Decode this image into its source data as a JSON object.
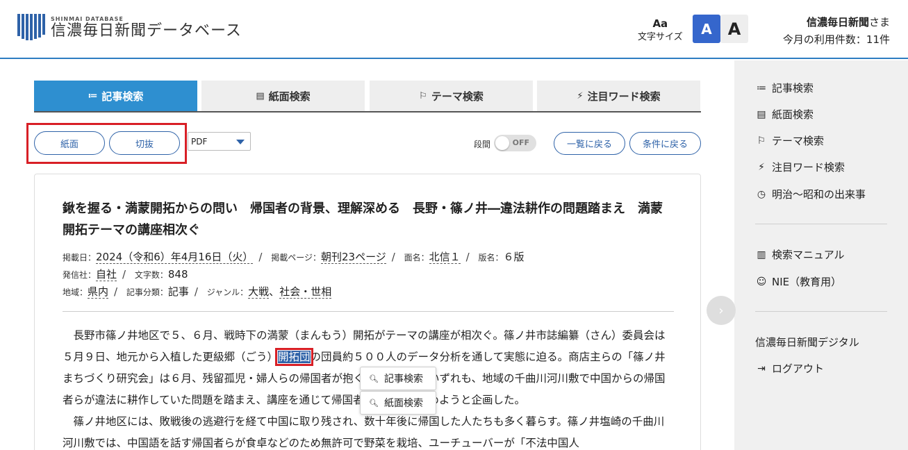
{
  "header": {
    "logo_sub": "SHINMAI DATABASE",
    "logo_main": "信濃毎日新聞データベース",
    "font_size_icon": "Aa",
    "font_size_label": "文字サイズ",
    "font_small": "A",
    "font_large": "A",
    "user_name": "信濃毎日新聞",
    "user_suffix": "さま",
    "usage": "今月の利用件数：11件"
  },
  "tabs": [
    {
      "label": "記事検索",
      "icon": "≔",
      "active": true
    },
    {
      "label": "紙面検索",
      "icon": "▤"
    },
    {
      "label": "テーマ検索",
      "icon": "⚐"
    },
    {
      "label": "注目ワード検索",
      "icon": "⚡"
    }
  ],
  "controls": {
    "btn_paper": "紙面",
    "btn_clip": "切抜",
    "format": "PDF",
    "toggle_label": "段間",
    "toggle_state": "OFF",
    "btn_back_list": "一覧に戻る",
    "btn_back_cond": "条件に戻る"
  },
  "article": {
    "title": "鍬を握る・満蒙開拓からの問い　帰国者の背景、理解深める　長野・篠ノ井―違法耕作の問題踏まえ　満蒙開拓テーマの講座相次ぐ",
    "meta1": {
      "k_date": "掲載日：",
      "date": "2024（令和6）年4月16日（火）",
      "k_page": "掲載ページ：",
      "page": "朝刊23ページ",
      "k_men": "面名：",
      "men": "北信１",
      "k_han": "版名：",
      "han": "６版"
    },
    "meta2": {
      "k_pub": "発信社：",
      "pub": "自社",
      "k_chars": "文字数：",
      "chars": "848"
    },
    "meta3": {
      "k_area": "地域：",
      "area": "県内",
      "k_cls": "記事分類：",
      "cls": "記事",
      "k_genre": "ジャンル：",
      "genre1": "大戦",
      "genre_sep": "、",
      "genre2": "社会・世相"
    },
    "p1_a": "長野市篠ノ井地区で５、６月、戦時下の満蒙（まんもう）開拓がテーマの講座が相次ぐ。篠ノ井市誌編纂（さん）委員会は５月９日、地元から入植した更級郷（ごう）",
    "p1_hl": "開拓団",
    "p1_b": "の団員約５００人のデータ分析を通して実態に迫る。商店主らの「篠ノ井まちづくり研究会」は６月、残留孤児・婦人らの帰国者が抱く課題を学ぶ。いずれも、地域の千曲川河川敷で中国からの帰国者らが違法に耕作していた問題を踏まえ、講座を通じて帰国者への理解を深めようと企画した。",
    "p2": "篠ノ井地区には、敗戦後の逃避行を経て中国に取り残され、数十年後に帰国した人たちも多く暮らす。篠ノ井塩崎の千曲川河川敷では、中国語を話す帰国者らが食卓などのため無許可で野菜を栽培、ユーチューバーが「不法中国人"
  },
  "context_menu": [
    {
      "label": "記事検索",
      "icon": "search-icon"
    },
    {
      "label": "紙面検索",
      "icon": "search-icon"
    }
  ],
  "sidebar": {
    "items": [
      {
        "label": "記事検索",
        "icon": "≔"
      },
      {
        "label": "紙面検索",
        "icon": "▤"
      },
      {
        "label": "テーマ検索",
        "icon": "⚐"
      },
      {
        "label": "注目ワード検索",
        "icon": "⚡"
      },
      {
        "label": "明治～昭和の出来事",
        "icon": "◷"
      }
    ],
    "items2": [
      {
        "label": "検索マニュアル",
        "icon": "▥"
      },
      {
        "label": "NIE（教育用）",
        "icon": "☺"
      }
    ],
    "digital": "信濃毎日新聞デジタル",
    "logout": "ログアウト",
    "logout_icon": "⇥"
  },
  "colors": {
    "accent": "#2e8fd0",
    "brand": "#2e62a8",
    "highlight_box": "#d81f26"
  }
}
